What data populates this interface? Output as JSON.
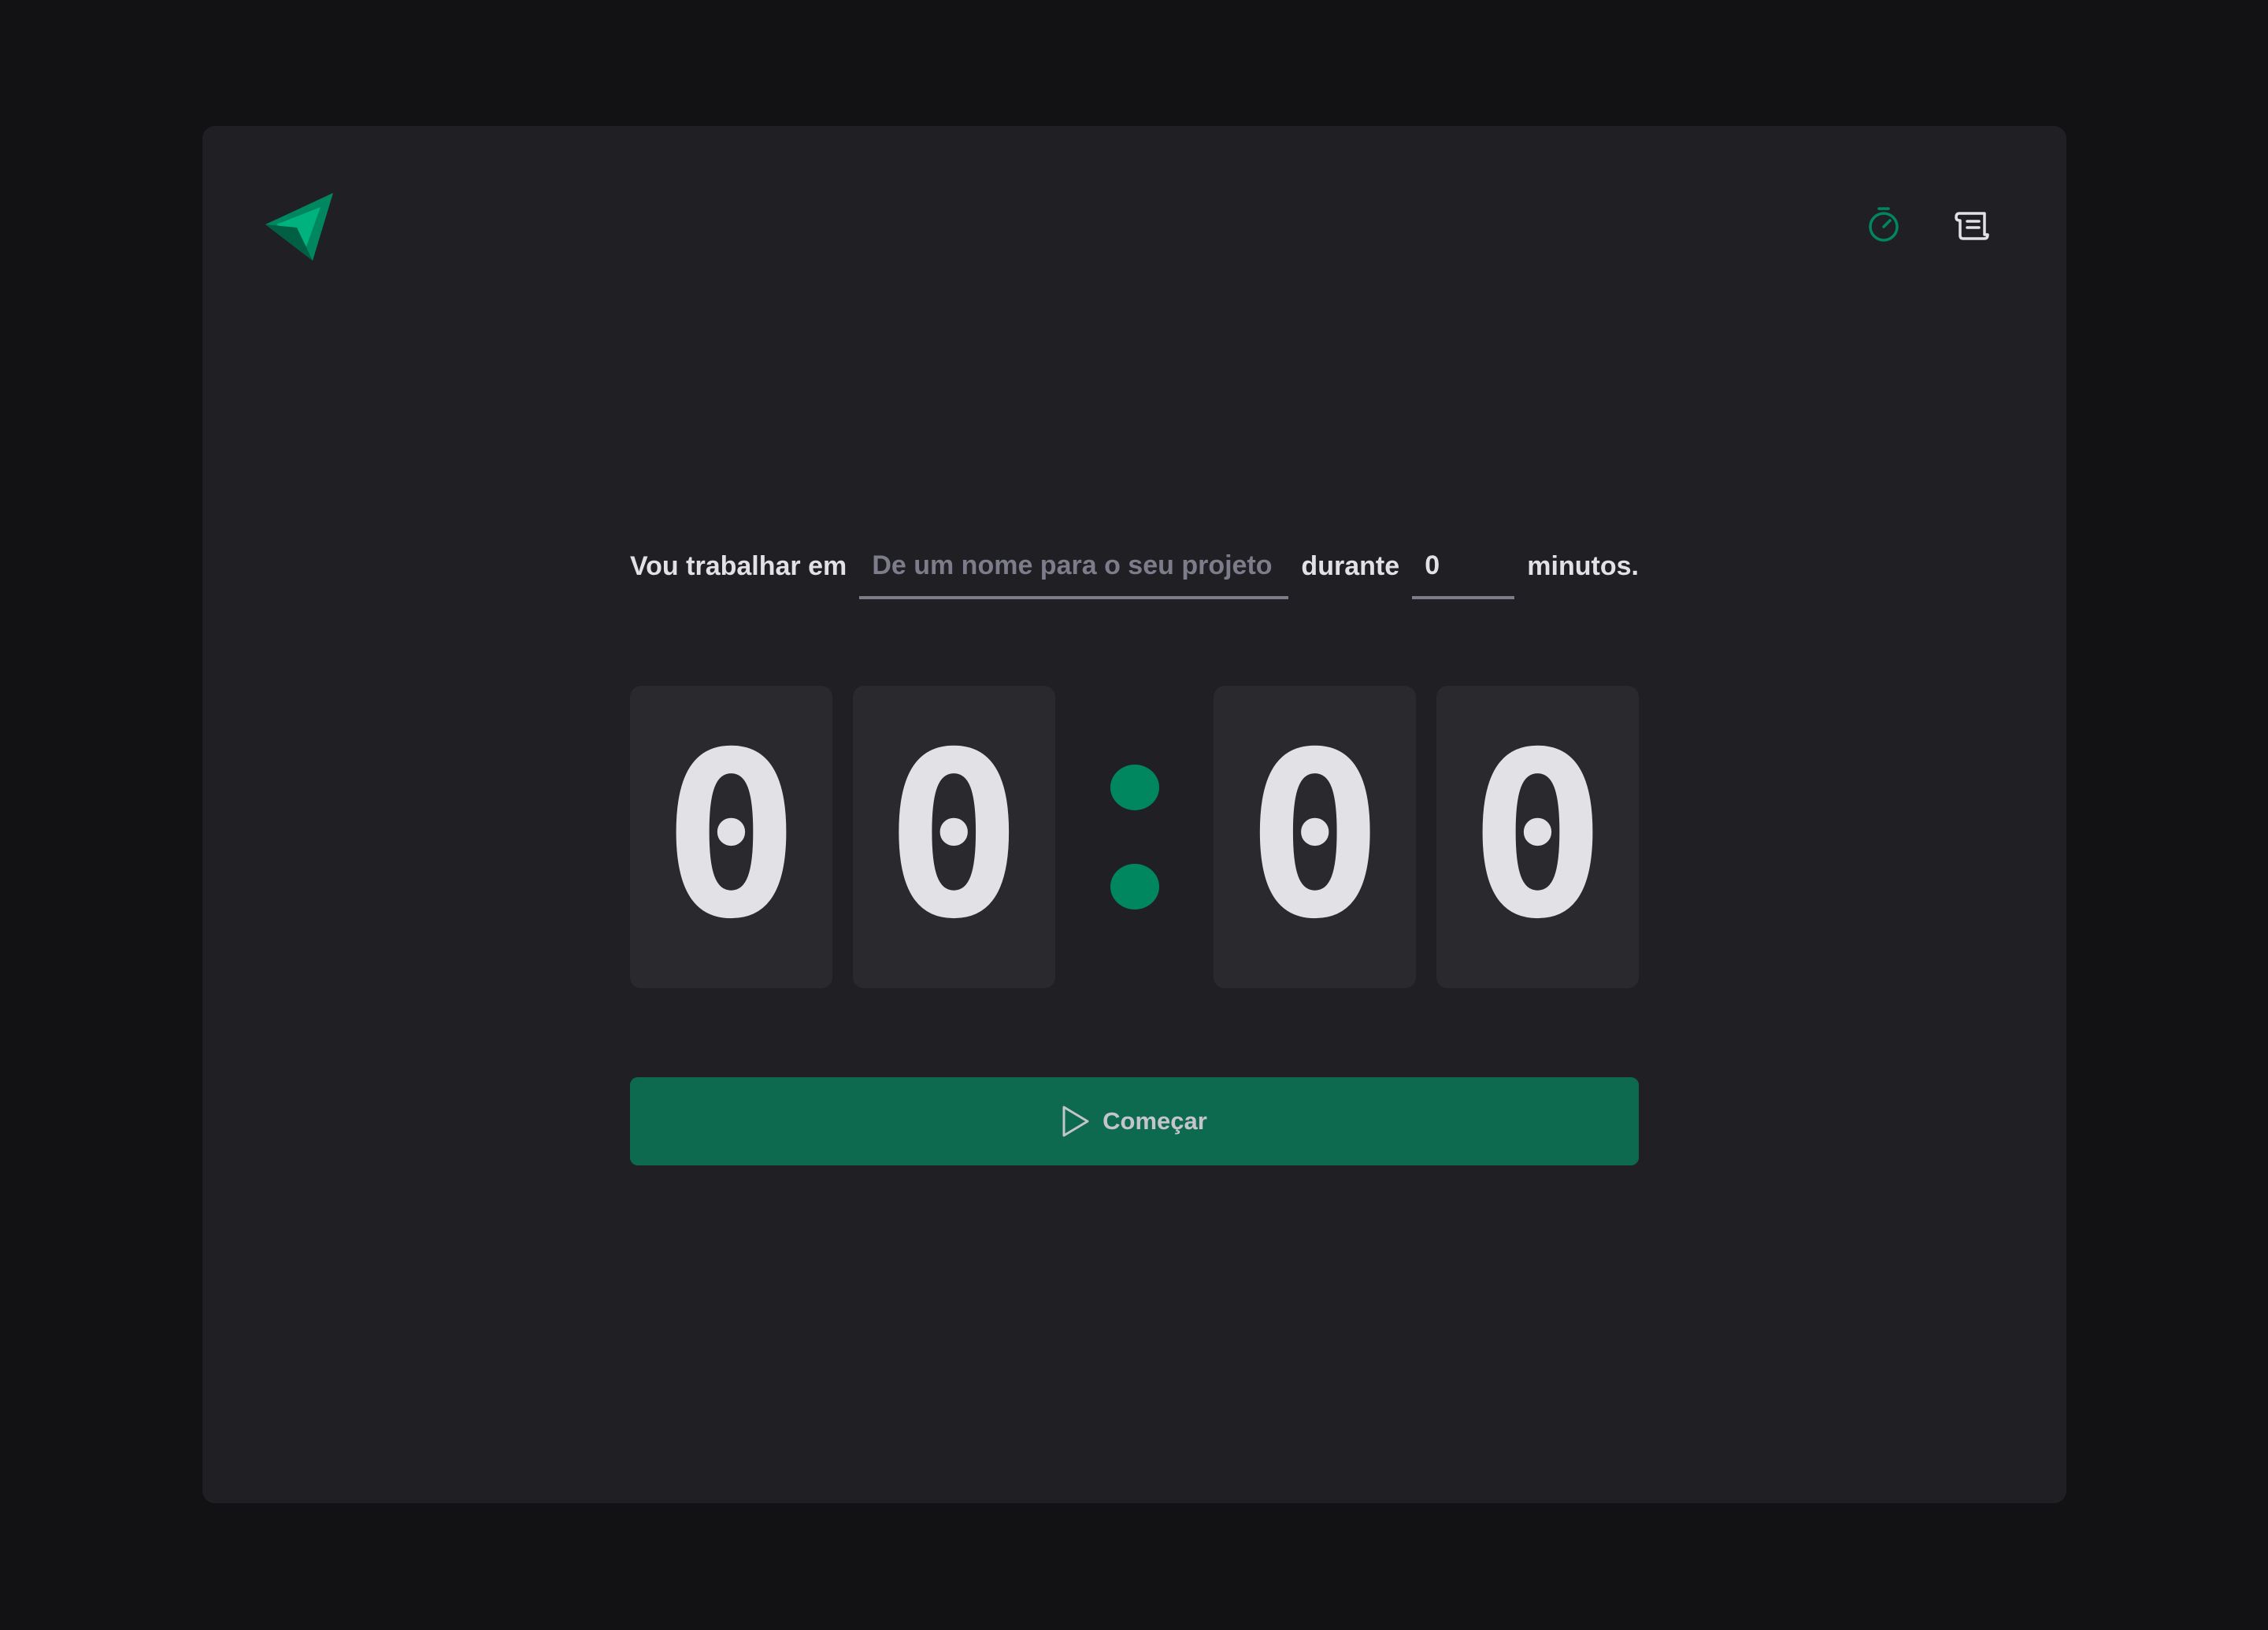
{
  "header": {
    "logo_icon": "ignite-triangle-logo-icon",
    "nav": [
      {
        "icon": "timer-icon",
        "color": "#00875f"
      },
      {
        "icon": "scroll-history-icon",
        "color": "#e1e1e6"
      }
    ]
  },
  "form": {
    "label_task": "Vou trabalhar em",
    "task_placeholder": "De um nome para o seu projeto",
    "label_duration": "durante",
    "minutes_value": "0",
    "label_minutes": "minutos."
  },
  "countdown": {
    "minutes_tens": "0",
    "minutes_ones": "0",
    "separator": ":",
    "seconds_tens": "0",
    "seconds_ones": "0"
  },
  "start_button": {
    "label": "Começar",
    "icon": "play-icon"
  },
  "colors": {
    "background": "#121214",
    "panel": "#202024",
    "digit_box": "#29292e",
    "accent": "#00875f",
    "button": "#0d6a4f",
    "text": "#e1e1e6",
    "placeholder": "#7c7c8a"
  }
}
